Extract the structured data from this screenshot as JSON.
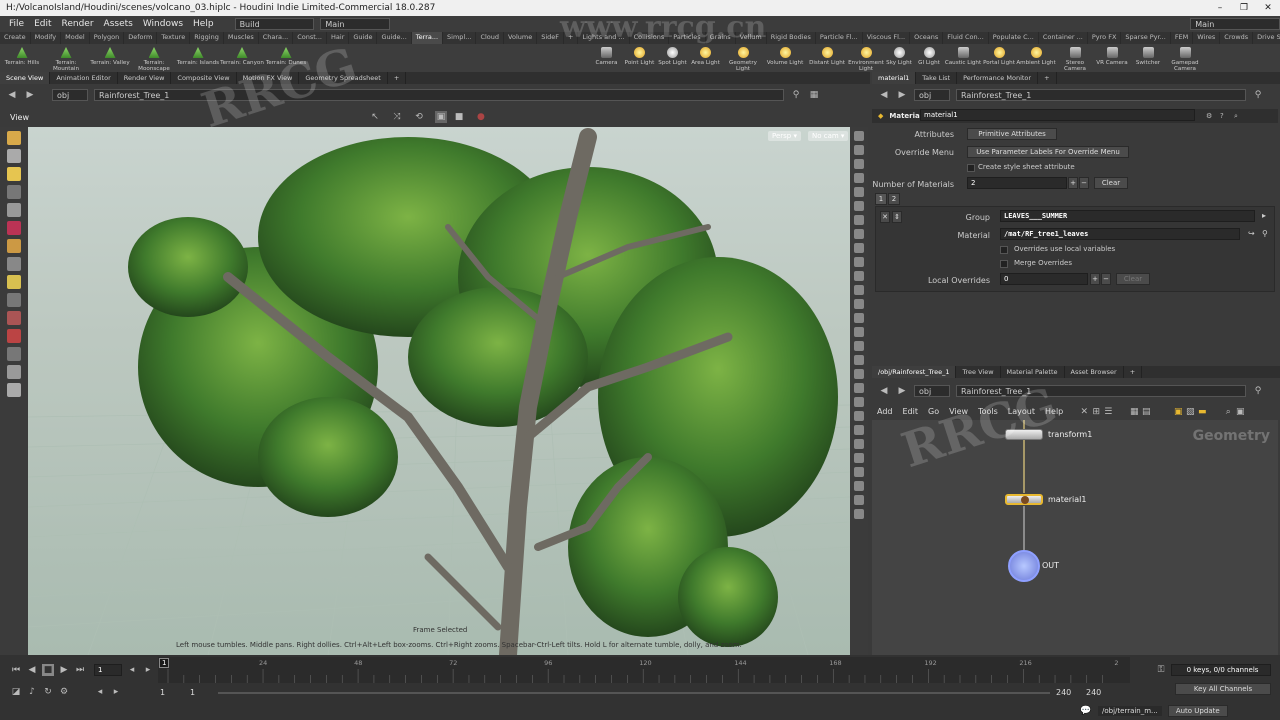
{
  "window": {
    "title": "H:/VolcanoIsland/Houdini/scenes/volcano_03.hiplc - Houdini Indie Limited-Commercial 18.0.287"
  },
  "menu": [
    "File",
    "Edit",
    "Render",
    "Assets",
    "Windows",
    "Help"
  ],
  "desktops": {
    "left": "Build",
    "center": "Main",
    "right": "Main"
  },
  "shelf_tabs_left": [
    "Create",
    "Modify",
    "Model",
    "Polygon",
    "Deform",
    "Texture",
    "Rigging",
    "Muscles",
    "Chara...",
    "Const...",
    "Hair",
    "Guide",
    "Guide...",
    "Terra...",
    "Simpl...",
    "Cloud",
    "Volume",
    "SideF"
  ],
  "shelf_tabs_right": [
    "Lights and ...",
    "Collisions",
    "Particles",
    "Grains",
    "Vellum",
    "Rigid Bodies",
    "Particle Fl...",
    "Viscous Fl...",
    "Oceans",
    "Fluid Con...",
    "Populate C...",
    "Container ...",
    "Pyro FX",
    "Sparse Pyr...",
    "FEM",
    "Wires",
    "Crowds",
    "Drive Sim..."
  ],
  "tools_left": [
    "Terrain: Hills",
    "Terrain: Mountain",
    "Terrain: Valley",
    "Terrain: Moonscape",
    "Terrain: Islands",
    "Terrain: Canyon",
    "Terrain: Dunes"
  ],
  "tools_right": [
    "Camera",
    "Point Light",
    "Spot Light",
    "Area Light",
    "Geometry Light",
    "Volume Light",
    "Distant Light",
    "Environment Light",
    "Sky Light",
    "GI Light",
    "Caustic Light",
    "Portal Light",
    "Ambient Light",
    "Stereo Camera",
    "VR Camera",
    "Switcher",
    "Gamepad Camera"
  ],
  "panel_tabs_left": [
    "Scene View",
    "Animation Editor",
    "Render View",
    "Composite View",
    "Motion FX View",
    "Geometry Spreadsheet"
  ],
  "panel_tabs_right": [
    "material1",
    "Take List",
    "Performance Monitor"
  ],
  "path": {
    "context": "obj",
    "node": "Rainforest_Tree_1"
  },
  "view": {
    "label": "View",
    "persp": "Persp",
    "cam": "No cam",
    "frame_status": "Frame Selected",
    "hint": "Left mouse tumbles. Middle pans. Right dollies. Ctrl+Alt+Left box-zooms. Ctrl+Right zooms. Spacebar-Ctrl-Left tilts. Hold L for alternate tumble, dolly, and zoom."
  },
  "params": {
    "node_type": "Material",
    "node_name": "material1",
    "attributes_label": "Attributes",
    "attributes_value": "Primitive Attributes",
    "override_label": "Override Menu",
    "override_value": "Use Parameter Labels For Override Menu",
    "stylesheet_label": "Create style sheet attribute",
    "num_materials_label": "Number of Materials",
    "num_materials_value": "2",
    "clear_label": "Clear",
    "tabs": [
      "1",
      "2"
    ],
    "group_label": "Group",
    "group_value": "LEAVES___SUMMER",
    "material_label": "Material",
    "material_value": "/mat/RF_tree1_leaves",
    "local_vars_label": "Overrides use local variables",
    "merge_label": "Merge Overrides",
    "local_overrides_label": "Local Overrides",
    "local_overrides_value": "0"
  },
  "net_tabs": [
    "/obj/Rainforest_Tree_1",
    "Tree View",
    "Material Palette",
    "Asset Browser"
  ],
  "net_menu": [
    "Add",
    "Edit",
    "Go",
    "View",
    "Tools",
    "Layout",
    "Help"
  ],
  "network": {
    "watermark": "Geometry",
    "nodes": [
      "transform1",
      "material1",
      "OUT"
    ]
  },
  "timeline": {
    "ticks": [
      "1",
      "24",
      "48",
      "72",
      "96",
      "120",
      "144",
      "168",
      "192",
      "216",
      "2"
    ],
    "frame": "1",
    "start": "1",
    "start2": "1",
    "end": "240",
    "end2": "240",
    "keys": "0 keys, 0/0 channels",
    "key_all": "Key All Channels",
    "status_path": "/obj/terrain_m...",
    "auto_update": "Auto Update"
  },
  "colors": {
    "accent": "#e8b830",
    "leaf_dark": "#2f5a22",
    "leaf_light": "#6ea63c",
    "trunk": "#6e6a62"
  }
}
